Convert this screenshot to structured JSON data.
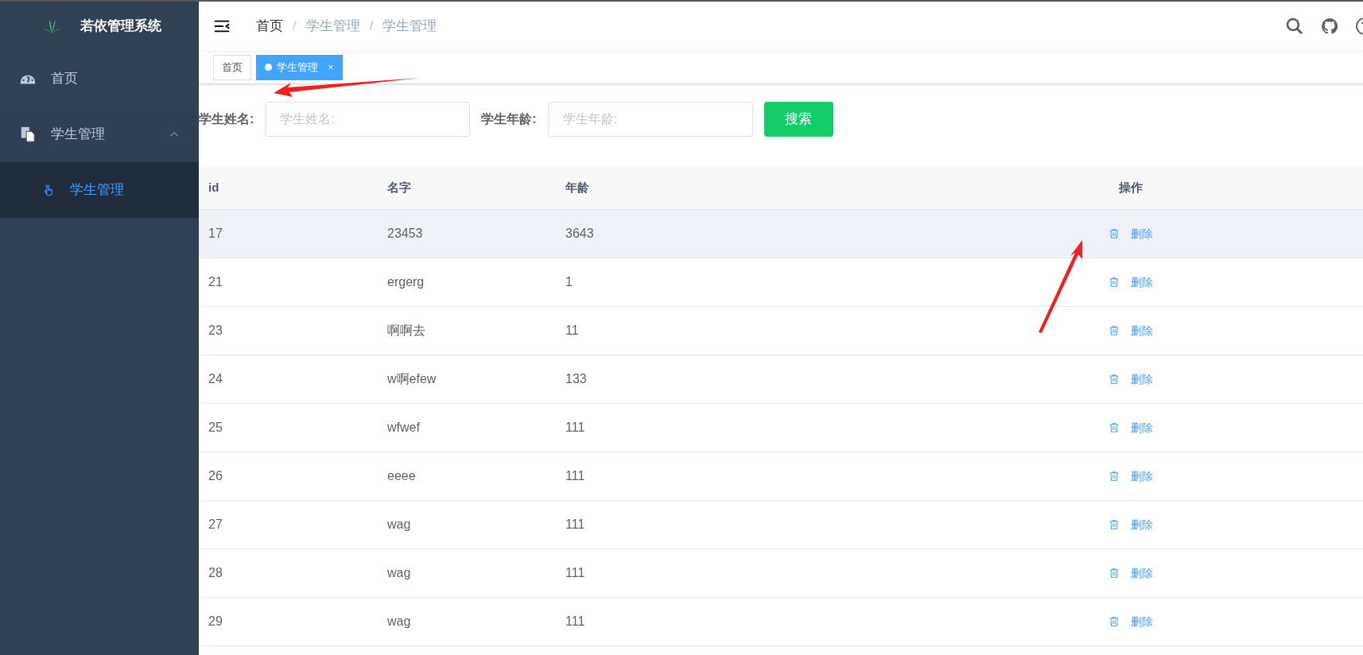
{
  "sidebar": {
    "title": "若依管理系统",
    "items": [
      {
        "label": "首页"
      },
      {
        "label": "学生管理",
        "expanded": true,
        "children": [
          {
            "label": "学生管理",
            "selected": true
          }
        ]
      }
    ]
  },
  "breadcrumb": [
    {
      "label": "首页",
      "current": false
    },
    {
      "label": "学生管理",
      "current": true
    },
    {
      "label": "学生管理",
      "current": true
    }
  ],
  "breadcrumb_separator": "/",
  "tags": [
    {
      "label": "首页",
      "selected": false
    },
    {
      "label": "学生管理",
      "selected": true,
      "close": "×"
    }
  ],
  "search": {
    "fields": [
      {
        "label": "学生姓名:",
        "placeholder": "学生姓名:"
      },
      {
        "label": "学生年龄:",
        "placeholder": "学生年龄:"
      }
    ],
    "button": "搜索"
  },
  "table": {
    "columns": [
      "id",
      "名字",
      "年龄",
      "操作"
    ],
    "rows": [
      {
        "id": "17",
        "name": "23453",
        "age": "3643",
        "action": "删除",
        "highlighted": true
      },
      {
        "id": "21",
        "name": "ergerg",
        "age": "1",
        "action": "删除",
        "highlighted": false
      },
      {
        "id": "23",
        "name": "啊啊去",
        "age": "11",
        "action": "删除",
        "highlighted": false
      },
      {
        "id": "24",
        "name": "w啊efew",
        "age": "133",
        "action": "删除",
        "highlighted": false
      },
      {
        "id": "25",
        "name": "wfwef",
        "age": "111",
        "action": "删除",
        "highlighted": false
      },
      {
        "id": "26",
        "name": "eeee",
        "age": "111",
        "action": "删除",
        "highlighted": false
      },
      {
        "id": "27",
        "name": "wag",
        "age": "111",
        "action": "删除",
        "highlighted": false
      },
      {
        "id": "28",
        "name": "wag",
        "age": "111",
        "action": "删除",
        "highlighted": false
      },
      {
        "id": "29",
        "name": "wag",
        "age": "111",
        "action": "删除",
        "highlighted": false
      }
    ]
  }
}
